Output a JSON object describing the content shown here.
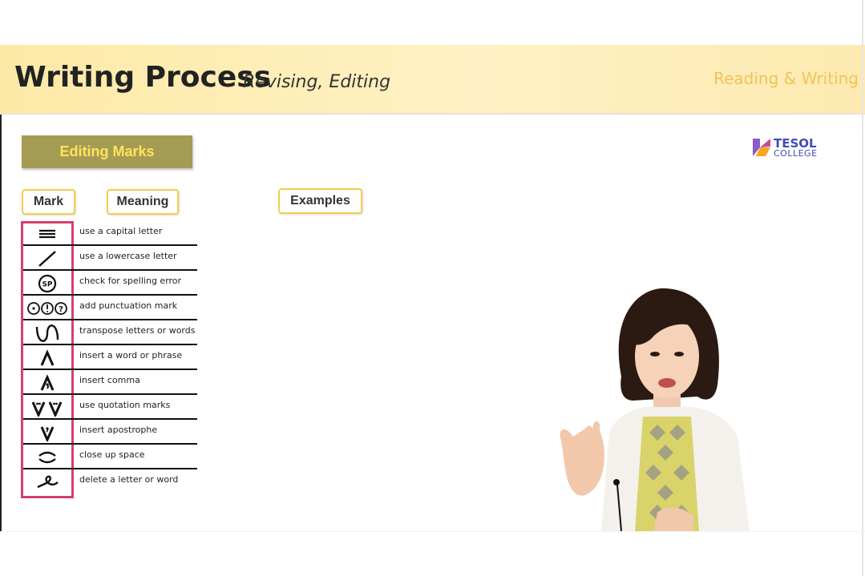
{
  "header": {
    "title": "Writing Process",
    "subtitle": "Revising, Editing",
    "course": "Reading & Writing"
  },
  "section": {
    "title": "Editing Marks",
    "col_mark": "Mark",
    "col_meaning": "Meaning",
    "col_examples": "Examples"
  },
  "logo": {
    "line1": "TESOL",
    "line2": "COLLEGE"
  },
  "marks": [
    {
      "icon": "triple-line-icon",
      "meaning": "use a capital letter"
    },
    {
      "icon": "slash-icon",
      "meaning": "use a lowercase letter"
    },
    {
      "icon": "circled-sp-icon",
      "meaning": "check for spelling error"
    },
    {
      "icon": "punctuation-circles-icon",
      "meaning": "add punctuation mark"
    },
    {
      "icon": "transpose-curve-icon",
      "meaning": "transpose letters or words"
    },
    {
      "icon": "caret-icon",
      "meaning": "insert a word or phrase"
    },
    {
      "icon": "comma-caret-icon",
      "meaning": "insert comma"
    },
    {
      "icon": "quotation-marks-icon",
      "meaning": "use quotation marks"
    },
    {
      "icon": "apostrophe-icon",
      "meaning": "insert apostrophe"
    },
    {
      "icon": "close-up-icon",
      "meaning": "close up space"
    },
    {
      "icon": "delete-squiggle-icon",
      "meaning": "delete a letter or word"
    }
  ],
  "colors": {
    "banner": "#fde9a6",
    "accent_box": "#a59c54",
    "accent_text": "#ffe45c",
    "mark_border": "#d43f73",
    "logo": "#3d4cb5"
  }
}
